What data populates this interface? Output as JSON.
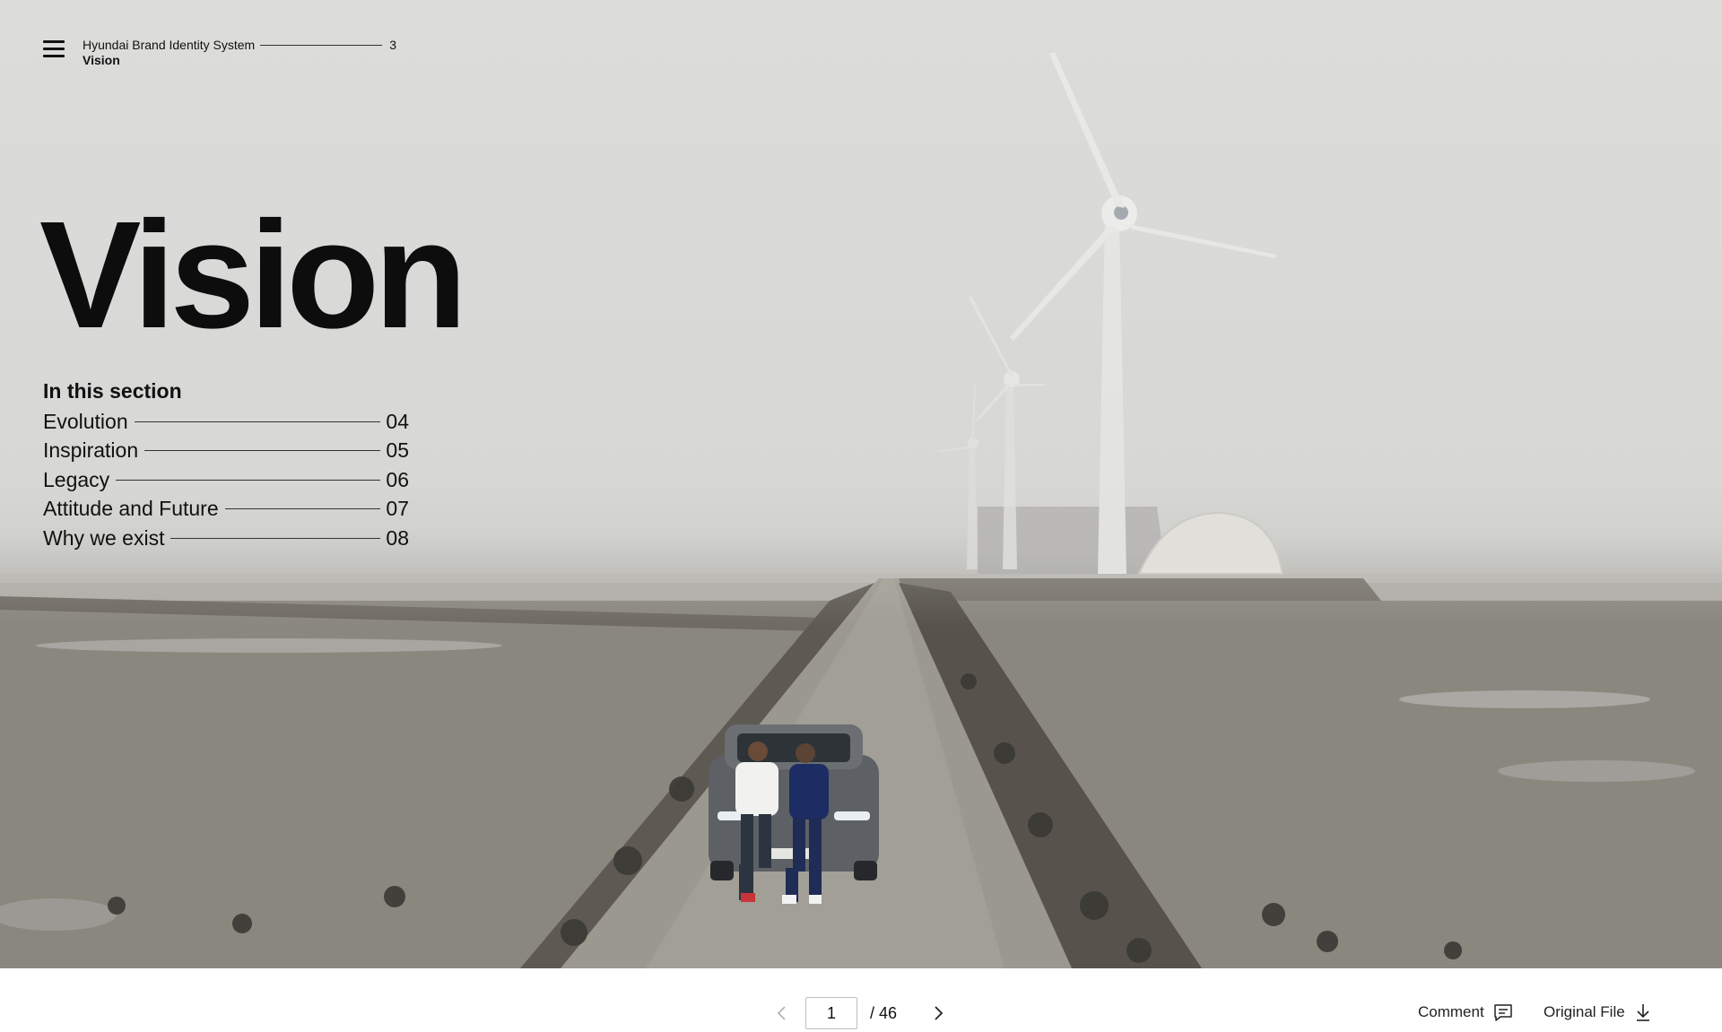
{
  "header": {
    "menu_icon": "hamburger-menu-icon",
    "doc_title": "Hyundai Brand Identity System",
    "page_num": "3",
    "section": "Vision"
  },
  "hero": {
    "title": "Vision",
    "toc_heading": "In this section",
    "toc": [
      {
        "label": "Evolution",
        "page": "04"
      },
      {
        "label": "Inspiration",
        "page": "05"
      },
      {
        "label": "Legacy",
        "page": "06"
      },
      {
        "label": "Attitude and Future",
        "page": "07"
      },
      {
        "label": "Why we exist",
        "page": "08"
      }
    ],
    "photo_description": "Two men sitting on the hood of a silver SUV on a narrow concrete causeway across tidal mudflats, wind turbines in the fog"
  },
  "toolbar": {
    "prev_icon": "chevron-left-icon",
    "next_icon": "chevron-right-icon",
    "current_page": "1",
    "total_pages": "/ 46",
    "comment_label": "Comment",
    "comment_icon": "comment-icon",
    "original_label": "Original File",
    "download_icon": "download-icon"
  },
  "colors": {
    "text": "#111111",
    "fog": "#d9d9d7",
    "ground": "#8e8a83",
    "toolbar_bg": "#ffffff"
  }
}
